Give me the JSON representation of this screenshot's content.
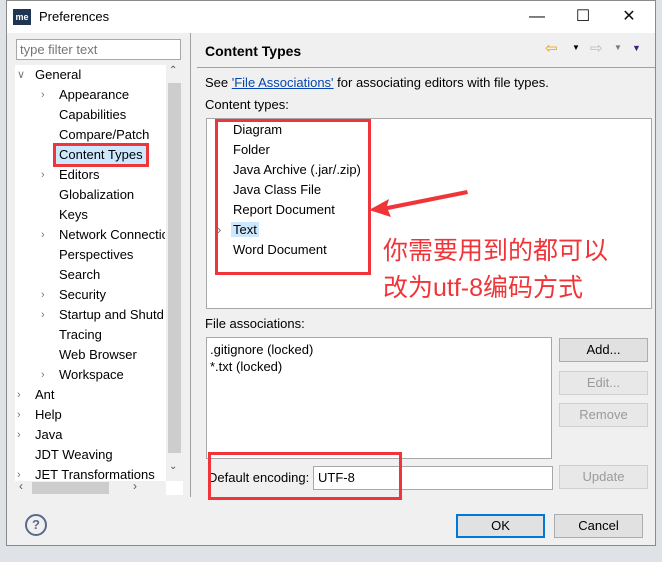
{
  "window": {
    "title": "Preferences",
    "logo": "me",
    "controls": [
      "minimize",
      "maximize",
      "close"
    ]
  },
  "filter": {
    "placeholder": "type filter text"
  },
  "tree": [
    {
      "label": "General",
      "level": 0,
      "expanded": true
    },
    {
      "label": "Appearance",
      "level": 1,
      "expandable": true
    },
    {
      "label": "Capabilities",
      "level": 1
    },
    {
      "label": "Compare/Patch",
      "level": 1
    },
    {
      "label": "Content Types",
      "level": 1,
      "selected": true
    },
    {
      "label": "Editors",
      "level": 1,
      "expandable": true
    },
    {
      "label": "Globalization",
      "level": 1
    },
    {
      "label": "Keys",
      "level": 1
    },
    {
      "label": "Network Connectio",
      "level": 1,
      "expandable": true
    },
    {
      "label": "Perspectives",
      "level": 1
    },
    {
      "label": "Search",
      "level": 1
    },
    {
      "label": "Security",
      "level": 1,
      "expandable": true
    },
    {
      "label": "Startup and Shutd",
      "level": 1,
      "expandable": true
    },
    {
      "label": "Tracing",
      "level": 1
    },
    {
      "label": "Web Browser",
      "level": 1
    },
    {
      "label": "Workspace",
      "level": 1,
      "expandable": true
    },
    {
      "label": "Ant",
      "level": 0,
      "expandable": true
    },
    {
      "label": "Help",
      "level": 0,
      "expandable": true
    },
    {
      "label": "Java",
      "level": 0,
      "expandable": true
    },
    {
      "label": "JDT Weaving",
      "level": 0
    },
    {
      "label": "JET Transformations",
      "level": 0,
      "expandable": true
    }
  ],
  "page": {
    "title": "Content Types",
    "desc_pre": "See ",
    "desc_link": "'File Associations'",
    "desc_post": " for associating editors with file types.",
    "content_types_label": "Content types:",
    "content_types": [
      {
        "label": "Diagram"
      },
      {
        "label": "Folder"
      },
      {
        "label": "Java Archive (.jar/.zip)"
      },
      {
        "label": "Java Class File"
      },
      {
        "label": "Report Document"
      },
      {
        "label": "Text",
        "expandable": true,
        "highlighted": true
      },
      {
        "label": "Word Document"
      }
    ],
    "annotation_line1": "你需要用到的都可以",
    "annotation_line2": "改为utf-8编码方式",
    "file_assoc_label": "File associations:",
    "file_assocs": [
      ".gitignore (locked)",
      "*.txt (locked)"
    ],
    "add": "Add...",
    "edit": "Edit...",
    "remove": "Remove",
    "encoding_label": "Default encoding:",
    "encoding_value": "UTF-8",
    "update": "Update"
  },
  "footer": {
    "ok": "OK",
    "cancel": "Cancel"
  },
  "colors": {
    "annotation": "#f0353a",
    "link": "#0645ad",
    "selection": "#cce8ff",
    "ok_border": "#0078d7"
  }
}
